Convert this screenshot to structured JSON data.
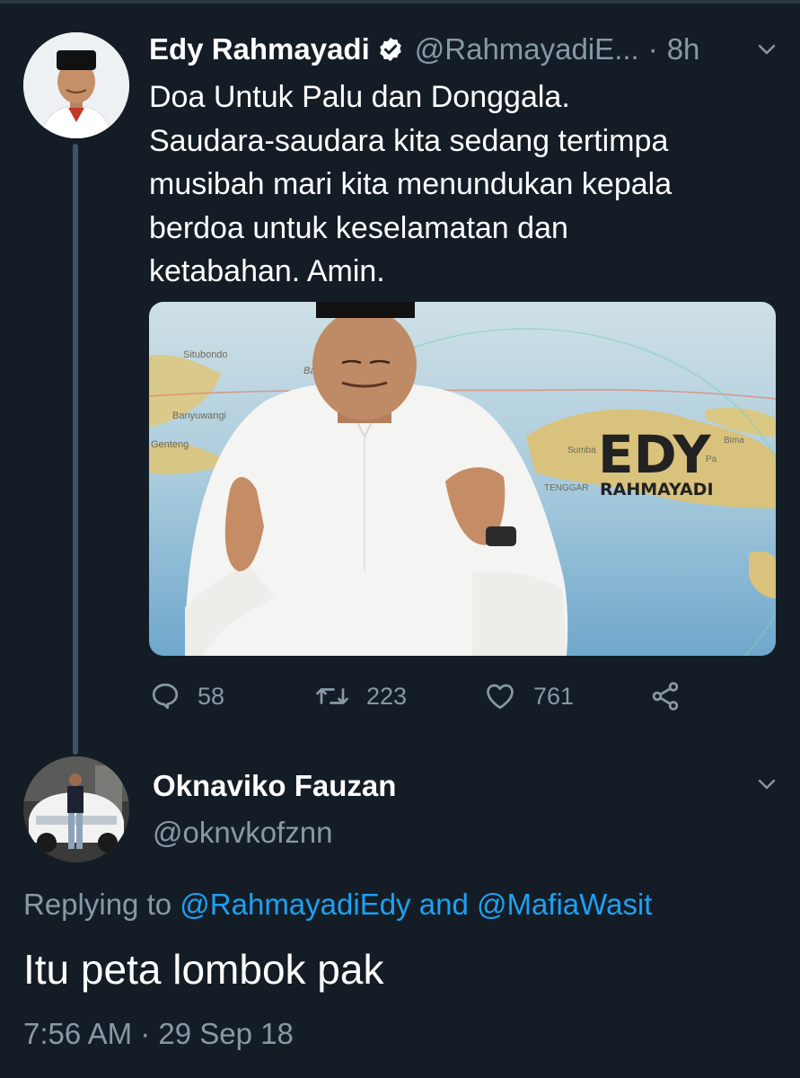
{
  "tweet": {
    "author_name": "Edy Rahmayadi",
    "author_handle": "@RahmayadiE...",
    "separator": "·",
    "time_ago": "8h",
    "text_lines": [
      "Doa Untuk Palu dan Donggala.",
      "Saudara-saudara kita sedang tertimpa",
      "musibah mari kita menundukan kepala",
      "berdoa untuk keselamatan dan",
      "ketabahan. Amin."
    ],
    "media": {
      "overlay_title": "EDY",
      "overlay_subtitle": "RAHMAYADI",
      "map_labels": [
        "Situbondo",
        "Bal",
        "Banyuwangi",
        "Genteng",
        "Sumba",
        "Bima",
        "TENGGAR",
        "Pa"
      ]
    },
    "actions": {
      "replies": "58",
      "retweets": "223",
      "likes": "761"
    },
    "icons": [
      "verified-badge-icon",
      "chevron-down-icon",
      "reply-icon",
      "retweet-icon",
      "like-icon",
      "share-icon"
    ]
  },
  "reply": {
    "author_name": "Oknaviko Fauzan",
    "author_handle": "@oknvkofznn",
    "replying_prefix": "Replying to",
    "replying_user1": "@RahmayadiEdy",
    "replying_and": "and",
    "replying_user2": "@MafiaWasit",
    "text": "Itu peta lombok pak",
    "time": "7:56 AM",
    "separator": "·",
    "date": "29 Sep 18"
  },
  "colors": {
    "background": "#141d26",
    "secondary_text": "#8899a6",
    "link": "#1da1f2",
    "thread_line": "#3d5466"
  }
}
